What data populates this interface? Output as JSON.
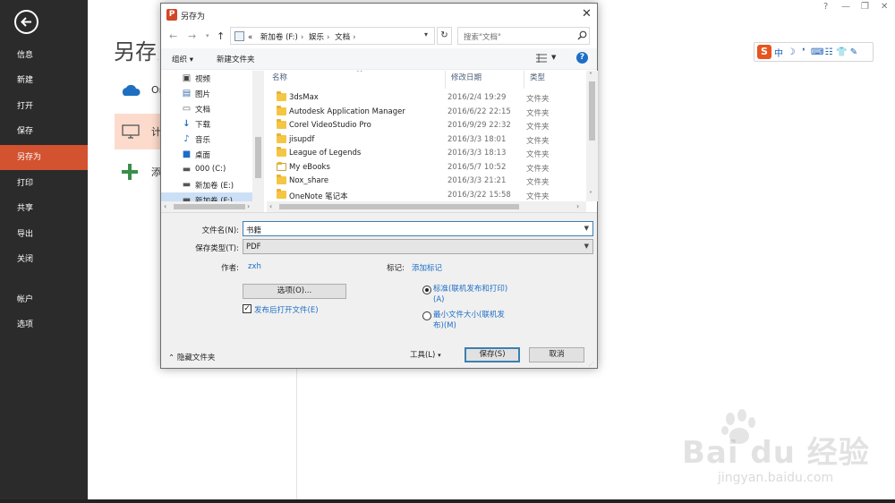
{
  "backstage": {
    "nav": [
      "信息",
      "新建",
      "打开",
      "保存",
      "另存为",
      "打印",
      "共享",
      "导出",
      "关闭",
      "帐户",
      "选项"
    ],
    "active": "另存为",
    "title": "另存为",
    "places": [
      {
        "icon": "onedrive-icon",
        "label": "OneDrive"
      },
      {
        "icon": "computer-icon",
        "label": "计算机"
      },
      {
        "icon": "add-place-icon",
        "label": "添加位置"
      }
    ]
  },
  "window_controls": {
    "help": "?",
    "restore": "❐",
    "minimize": "—",
    "close": "✕"
  },
  "ime_toolbar": {
    "logo": "S",
    "mode": "中",
    "items": [
      "中",
      "☽",
      "❜",
      "⌨",
      "☷",
      "👕",
      "✎"
    ]
  },
  "watermark": {
    "brand": "Bai du 经验",
    "url": "jingyan.baidu.com"
  },
  "dialog": {
    "title": "另存为",
    "breadcrumb": [
      "新加卷 (F:)",
      "娱乐",
      "文档"
    ],
    "breadcrumb_prefix": "«",
    "search_placeholder": "搜索\"文档\"",
    "toolbar": {
      "organize": "组织 ▾",
      "new_folder": "新建文件夹"
    },
    "tree": [
      {
        "icon": "video-icon",
        "label": "视频"
      },
      {
        "icon": "pictures-icon",
        "label": "图片"
      },
      {
        "icon": "documents-icon",
        "label": "文档"
      },
      {
        "icon": "downloads-icon",
        "label": "下载"
      },
      {
        "icon": "music-icon",
        "label": "音乐"
      },
      {
        "icon": "desktop-icon",
        "label": "桌面"
      },
      {
        "icon": "drive-c-icon",
        "label": "000 (C:)"
      },
      {
        "icon": "drive-e-icon",
        "label": "新加卷 (E:)"
      },
      {
        "icon": "drive-f-icon",
        "label": "新加卷 (F:)"
      }
    ],
    "tree_selected": 8,
    "columns": [
      "名称",
      "修改日期",
      "类型"
    ],
    "files": [
      {
        "name": "3dsMax",
        "date": "2016/2/4 19:29",
        "type": "文件夹"
      },
      {
        "name": "Autodesk Application Manager",
        "date": "2016/6/22 22:15",
        "type": "文件夹"
      },
      {
        "name": "Corel VideoStudio Pro",
        "date": "2016/9/29 22:32",
        "type": "文件夹"
      },
      {
        "name": "jisupdf",
        "date": "2016/3/3 18:01",
        "type": "文件夹"
      },
      {
        "name": "League of Legends",
        "date": "2016/3/3 18:13",
        "type": "文件夹"
      },
      {
        "name": "My eBooks",
        "date": "2016/5/7 10:52",
        "type": "文件夹"
      },
      {
        "name": "Nox_share",
        "date": "2016/3/3 21:21",
        "type": "文件夹"
      },
      {
        "name": "OneNote 笔记本",
        "date": "2016/3/22 15:58",
        "type": "文件夹"
      }
    ],
    "filename_label": "文件名(N):",
    "filename_value": "书籍",
    "filetype_label": "保存类型(T):",
    "filetype_value": "PDF",
    "author_label": "作者:",
    "author_value": "zxh",
    "tags_label": "标记:",
    "tags_value": "添加标记",
    "options_button": "选项(O)...",
    "open_after_publish": "发布后打开文件(E)",
    "optimize_options": [
      "标准(联机发布和打印)(A)",
      "最小文件大小(联机发布)(M)"
    ],
    "optimize_selected": 0,
    "hide_folders": "隐藏文件夹",
    "tools_button": "工具(L)",
    "save_button": "保存(S)",
    "cancel_button": "取消"
  }
}
